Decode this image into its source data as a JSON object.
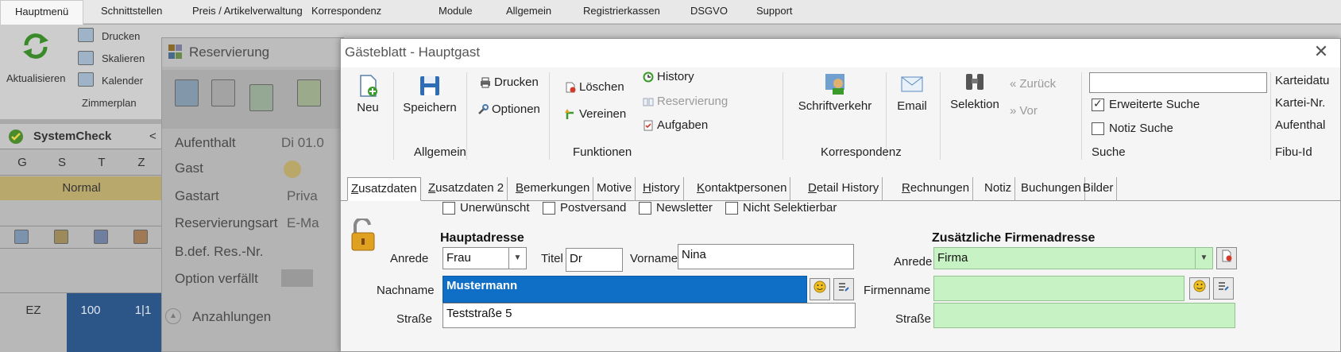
{
  "menubar": {
    "tabs": [
      "Hauptmenü",
      "Schnittstellen",
      "Preis / Artikelverwaltung",
      "Korrespondenz",
      "Module",
      "Allgemein",
      "Registrierkassen",
      "DSGVO",
      "Support"
    ]
  },
  "bg_ribbon": {
    "aktualisieren": "Aktualisieren",
    "drucken": "Drucken",
    "skalieren": "Skalieren",
    "kalender": "Kalender",
    "zimmerplan": "Zimmerplan"
  },
  "systemcheck": {
    "title": "SystemCheck",
    "cols": [
      "G",
      "S",
      "T",
      "Z"
    ],
    "normal": "Normal",
    "row_ez": "EZ",
    "row_100": "100",
    "row_11": "1|1"
  },
  "reservierung": {
    "title": "Reservierung",
    "labels": [
      "Aufenthalt",
      "Gast",
      "Gastart",
      "Reservierungsart",
      "B.def. Res.-Nr.",
      "Option verfällt",
      "Anzahlungen"
    ],
    "aufenthalt_val": "Di 01.0",
    "gastart_val": "Priva",
    "resart_val": "E-Ma"
  },
  "dialog": {
    "title": "Gästeblatt - Hauptgast",
    "ribbon": {
      "neu": "Neu",
      "speichern": "Speichern",
      "drucken": "Drucken",
      "optionen": "Optionen",
      "group_allgemein": "Allgemein",
      "loeschen": "Löschen",
      "vereinen": "Vereinen",
      "history": "History",
      "reservierung": "Reservierung",
      "aufgaben": "Aufgaben",
      "group_funktionen": "Funktionen",
      "schriftverkehr": "Schriftverkehr",
      "email": "Email",
      "group_korrespondenz": "Korrespondenz",
      "selektion": "Selektion",
      "zurueck": "Zurück",
      "vor": "Vor",
      "search_value": "",
      "erweiterte_suche": "Erweiterte Suche",
      "notiz_suche": "Notiz Suche",
      "group_suche": "Suche",
      "karteidatum": "Karteidatu",
      "karteinr": "Kartei-Nr.",
      "aufenthal": "Aufenthal",
      "fibuid": "Fibu-Id"
    },
    "tabs": [
      {
        "u": "Z",
        "rest": "usatzdaten"
      },
      {
        "u": "Z",
        "rest": "usatzdaten 2"
      },
      {
        "u": "B",
        "rest": "emerkungen"
      },
      {
        "u": "",
        "rest": "Motive"
      },
      {
        "u": "H",
        "rest": "istory"
      },
      {
        "u": "K",
        "rest": "ontaktpersonen"
      },
      {
        "u": "D",
        "rest": "etail History"
      },
      {
        "u": "R",
        "rest": "echnungen"
      },
      {
        "u": "",
        "rest": "Notiz"
      },
      {
        "u": "",
        "rest": "Buchungen"
      },
      {
        "u": "",
        "rest": "Bilder"
      }
    ],
    "flags": {
      "unerwuenscht": "Unerwünscht",
      "postversand": "Postversand",
      "newsletter": "Newsletter",
      "nicht_selektierbar": "Nicht Selektierbar"
    },
    "hauptadresse": {
      "title": "Hauptadresse",
      "anrede_label": "Anrede",
      "anrede_value": "Frau",
      "titel_label": "Titel",
      "titel_value": "Dr",
      "vorname_label": "Vorname",
      "vorname_value": "Nina",
      "nachname_label": "Nachname",
      "nachname_value": "Mustermann",
      "strasse_label": "Straße",
      "strasse_value": "Teststraße 5"
    },
    "firmenadresse": {
      "title": "Zusätzliche Firmenadresse",
      "anrede_label": "Anrede",
      "anrede_value": "Firma",
      "firmenname_label": "Firmenname",
      "firmenname_value": "",
      "strasse_label": "Straße",
      "strasse_value": ""
    }
  },
  "colors": {
    "accent_blue": "#0f6fc6",
    "green_field": "#c7f2c3",
    "normal_band": "#e9d27a",
    "cell_blue": "#1f5fa8"
  }
}
